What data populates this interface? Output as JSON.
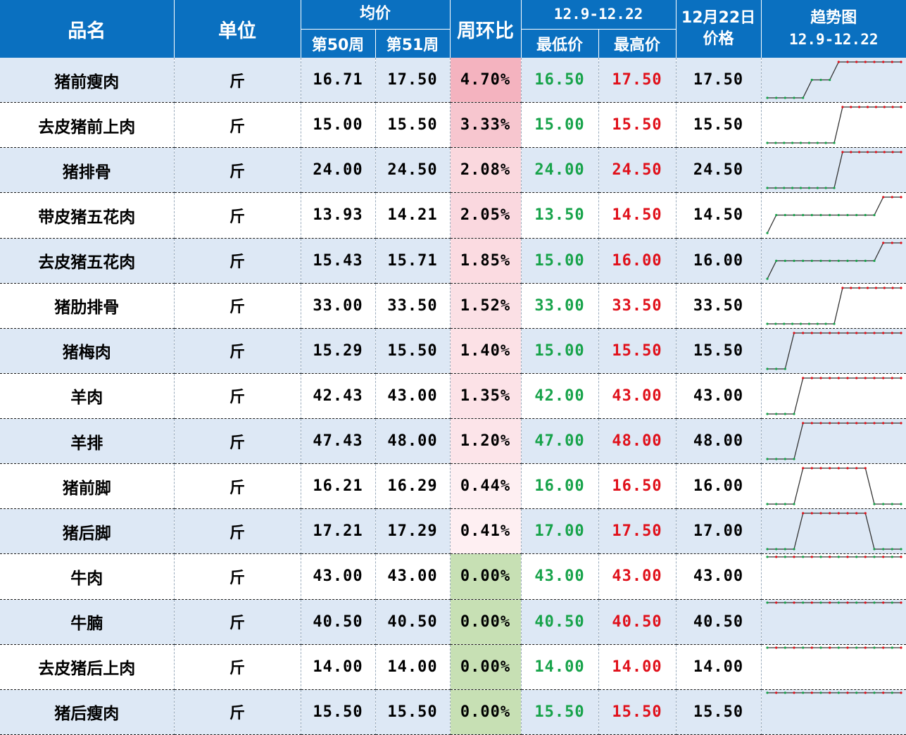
{
  "header": {
    "name": "品名",
    "unit": "单位",
    "avg_price": "均价",
    "week50": "第50周",
    "week51": "第51周",
    "wow": "周环比",
    "range": "12.9-12.22",
    "min": "最低价",
    "max": "最高价",
    "date_line1": "12月22日",
    "date_line2": "价格",
    "trend_line1": "趋势图",
    "trend_line2": "12.9-12.22"
  },
  "colors": {
    "header_bg": "#0a70c0",
    "row_alt": "#dde8f5",
    "low": "#17a34a",
    "high": "#e0101a",
    "wow_scale_up": "#f4b3bf",
    "wow_zero": "#c7e0b4"
  },
  "rows": [
    {
      "name": "猪前瘦肉",
      "unit": "斤",
      "w50": "16.71",
      "w51": "17.50",
      "wow": "4.70%",
      "wow_value": 4.7,
      "min": "16.50",
      "max": "17.50",
      "price": "17.50",
      "trend": [
        0,
        0,
        0,
        0,
        0,
        0.5,
        0.5,
        0.5,
        1,
        1,
        1,
        1,
        1,
        1,
        1,
        1
      ]
    },
    {
      "name": "去皮猪前上肉",
      "unit": "斤",
      "w50": "15.00",
      "w51": "15.50",
      "wow": "3.33%",
      "wow_value": 3.33,
      "min": "15.00",
      "max": "15.50",
      "price": "15.50",
      "trend": [
        0,
        0,
        0,
        0,
        0,
        0,
        0,
        0,
        0,
        1,
        1,
        1,
        1,
        1,
        1,
        1,
        1
      ]
    },
    {
      "name": "猪排骨",
      "unit": "斤",
      "w50": "24.00",
      "w51": "24.50",
      "wow": "2.08%",
      "wow_value": 2.08,
      "min": "24.00",
      "max": "24.50",
      "price": "24.50",
      "trend": [
        0,
        0,
        0,
        0,
        0,
        0,
        0,
        0,
        0,
        1,
        1,
        1,
        1,
        1,
        1,
        1,
        1
      ]
    },
    {
      "name": "带皮猪五花肉",
      "unit": "斤",
      "w50": "13.93",
      "w51": "14.21",
      "wow": "2.05%",
      "wow_value": 2.05,
      "min": "13.50",
      "max": "14.50",
      "price": "14.50",
      "trend": [
        0,
        0.5,
        0.5,
        0.5,
        0.5,
        0.5,
        0.5,
        0.5,
        0.5,
        0.5,
        0.5,
        0.5,
        0.5,
        1,
        1,
        1
      ]
    },
    {
      "name": "去皮猪五花肉",
      "unit": "斤",
      "w50": "15.43",
      "w51": "15.71",
      "wow": "1.85%",
      "wow_value": 1.85,
      "min": "15.00",
      "max": "16.00",
      "price": "16.00",
      "trend": [
        0,
        0.5,
        0.5,
        0.5,
        0.5,
        0.5,
        0.5,
        0.5,
        0.5,
        0.5,
        0.5,
        0.5,
        0.5,
        1,
        1,
        1
      ]
    },
    {
      "name": "猪肋排骨",
      "unit": "斤",
      "w50": "33.00",
      "w51": "33.50",
      "wow": "1.52%",
      "wow_value": 1.52,
      "min": "33.00",
      "max": "33.50",
      "price": "33.50",
      "trend": [
        0,
        0,
        0,
        0,
        0,
        0,
        0,
        0,
        0,
        1,
        1,
        1,
        1,
        1,
        1,
        1,
        1
      ]
    },
    {
      "name": "猪梅肉",
      "unit": "斤",
      "w50": "15.29",
      "w51": "15.50",
      "wow": "1.40%",
      "wow_value": 1.4,
      "min": "15.00",
      "max": "15.50",
      "price": "15.50",
      "trend": [
        0,
        0,
        0,
        1,
        1,
        1,
        1,
        1,
        1,
        1,
        1,
        1,
        1,
        1,
        1,
        1
      ]
    },
    {
      "name": "羊肉",
      "unit": "斤",
      "w50": "42.43",
      "w51": "43.00",
      "wow": "1.35%",
      "wow_value": 1.35,
      "min": "42.00",
      "max": "43.00",
      "price": "43.00",
      "trend": [
        0,
        0,
        0,
        0,
        1,
        1,
        1,
        1,
        1,
        1,
        1,
        1,
        1,
        1,
        1,
        1
      ]
    },
    {
      "name": "羊排",
      "unit": "斤",
      "w50": "47.43",
      "w51": "48.00",
      "wow": "1.20%",
      "wow_value": 1.2,
      "min": "47.00",
      "max": "48.00",
      "price": "48.00",
      "trend": [
        0,
        0,
        0,
        0,
        1,
        1,
        1,
        1,
        1,
        1,
        1,
        1,
        1,
        1,
        1,
        1
      ]
    },
    {
      "name": "猪前脚",
      "unit": "斤",
      "w50": "16.21",
      "w51": "16.29",
      "wow": "0.44%",
      "wow_value": 0.44,
      "min": "16.00",
      "max": "16.50",
      "price": "16.00",
      "trend": [
        0,
        0,
        0,
        0,
        1,
        1,
        1,
        1,
        1,
        1,
        1,
        1,
        0,
        0,
        0,
        0
      ]
    },
    {
      "name": "猪后脚",
      "unit": "斤",
      "w50": "17.21",
      "w51": "17.29",
      "wow": "0.41%",
      "wow_value": 0.41,
      "min": "17.00",
      "max": "17.50",
      "price": "17.00",
      "trend": [
        0,
        0,
        0,
        0,
        1,
        1,
        1,
        1,
        1,
        1,
        1,
        1,
        0,
        0,
        0,
        0
      ]
    },
    {
      "name": "牛肉",
      "unit": "斤",
      "w50": "43.00",
      "w51": "43.00",
      "wow": "0.00%",
      "wow_value": 0.0,
      "min": "43.00",
      "max": "43.00",
      "price": "43.00",
      "trend": [
        1,
        1,
        1,
        1,
        1,
        1,
        1,
        1,
        1,
        1,
        1,
        1,
        1,
        1,
        1,
        1
      ]
    },
    {
      "name": "牛腩",
      "unit": "斤",
      "w50": "40.50",
      "w51": "40.50",
      "wow": "0.00%",
      "wow_value": 0.0,
      "min": "40.50",
      "max": "40.50",
      "price": "40.50",
      "trend": [
        1,
        1,
        1,
        1,
        1,
        1,
        1,
        1,
        1,
        1,
        1,
        1,
        1,
        1,
        1,
        1
      ]
    },
    {
      "name": "去皮猪后上肉",
      "unit": "斤",
      "w50": "14.00",
      "w51": "14.00",
      "wow": "0.00%",
      "wow_value": 0.0,
      "min": "14.00",
      "max": "14.00",
      "price": "14.00",
      "trend": [
        1,
        1,
        1,
        1,
        1,
        1,
        1,
        1,
        1,
        1,
        1,
        1,
        1,
        1,
        1,
        1
      ]
    },
    {
      "name": "猪后瘦肉",
      "unit": "斤",
      "w50": "15.50",
      "w51": "15.50",
      "wow": "0.00%",
      "wow_value": 0.0,
      "min": "15.50",
      "max": "15.50",
      "price": "15.50",
      "trend": [
        1,
        1,
        1,
        1,
        1,
        1,
        1,
        1,
        1,
        1,
        1,
        1,
        1,
        1,
        1,
        1
      ]
    }
  ]
}
